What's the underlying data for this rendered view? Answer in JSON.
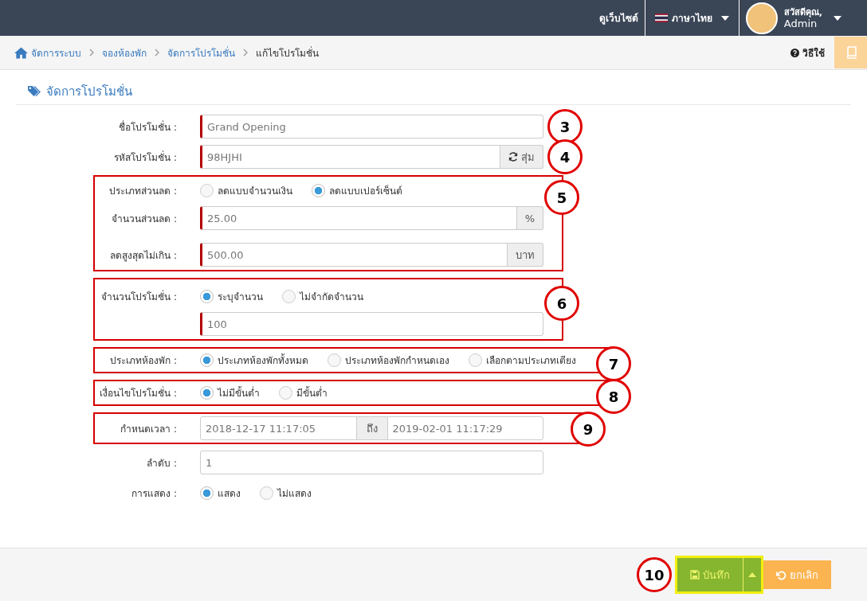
{
  "topbar": {
    "site_link": "ดูเว็บไซต์",
    "language": "ภาษาไทย",
    "greeting": "สวัสดีคุณ,",
    "user": "Admin"
  },
  "breadcrumb": [
    {
      "label": "จัดการระบบ",
      "current": false
    },
    {
      "label": "จองห้องพัก",
      "current": false
    },
    {
      "label": "จัดการโปรโมชั่น",
      "current": false
    },
    {
      "label": "แก้ไขโปรโมชั่น",
      "current": true
    }
  ],
  "help": "วิธีใช้",
  "heading": "จัดการโปรโมชั่น",
  "form": [
    {
      "kind": "text",
      "label": "ชื่อโปรโมชั่น :",
      "value": "Grand Opening",
      "required": true,
      "callout": "3"
    },
    {
      "kind": "button",
      "label": "รหัสโปรโมชั่น :",
      "value": "98HJHI",
      "required": true,
      "button": "สุ่ม",
      "callout": "4"
    },
    {
      "kind": "group",
      "callout": "5",
      "rows": [
        {
          "kind": "radio",
          "label": "ประเภทส่วนลด :",
          "options": [
            {
              "label": "ลดแบบจำนวนเงิน",
              "selected": false
            },
            {
              "label": "ลดแบบเปอร์เซ็นต์",
              "selected": true
            }
          ]
        },
        {
          "kind": "addon",
          "label": "จำนวนส่วนลด :",
          "value": "25.00",
          "required": true,
          "addon": "%"
        },
        {
          "kind": "addon",
          "label": "ลดสูงสุดไม่เกิน :",
          "value": "500.00",
          "required": true,
          "addon": "บาท"
        }
      ]
    },
    {
      "kind": "group",
      "callout": "6",
      "rows": [
        {
          "kind": "radio",
          "label": "จำนวนโปรโมชั่น :",
          "options": [
            {
              "label": "ระบุจำนวน",
              "selected": true
            },
            {
              "label": "ไม่จำกัดจำนวน",
              "selected": false
            }
          ]
        },
        {
          "kind": "text",
          "value": "100",
          "required": true
        }
      ]
    },
    {
      "kind": "group",
      "callout": "7",
      "rows": [
        {
          "kind": "radio",
          "label": "ประเภทห้องพัก :",
          "options": [
            {
              "label": "ประเภทห้องพักทั้งหมด",
              "selected": true
            },
            {
              "label": "ประเภทห้องพักกำหนดเอง",
              "selected": false
            },
            {
              "label": "เลือกตามประเภทเตียง",
              "selected": false
            }
          ]
        }
      ]
    },
    {
      "kind": "group",
      "callout": "8",
      "rows": [
        {
          "kind": "radio",
          "label": "เงื่อนไขโปรโมชั่น :",
          "options": [
            {
              "label": "ไม่มีขั้นต่ำ",
              "selected": true
            },
            {
              "label": "มีขั้นต่ำ",
              "selected": false
            }
          ]
        }
      ]
    },
    {
      "kind": "group",
      "callout": "9",
      "rows": [
        {
          "kind": "daterange",
          "label": "กำหนดเวลา :",
          "from": "2018-12-17 11:17:05",
          "joiner": "ถึง",
          "to": "2019-02-01 11:17:29"
        }
      ]
    },
    {
      "kind": "text",
      "label": "ลำดับ :",
      "value": "1",
      "required": false
    },
    {
      "kind": "radio",
      "label": "การแสดง :",
      "options": [
        {
          "label": "แสดง",
          "selected": true
        },
        {
          "label": "ไม่แสดง",
          "selected": false
        }
      ]
    }
  ],
  "footer": {
    "callout": "10",
    "save": "บันทึก",
    "cancel": "ยกเลิก"
  }
}
